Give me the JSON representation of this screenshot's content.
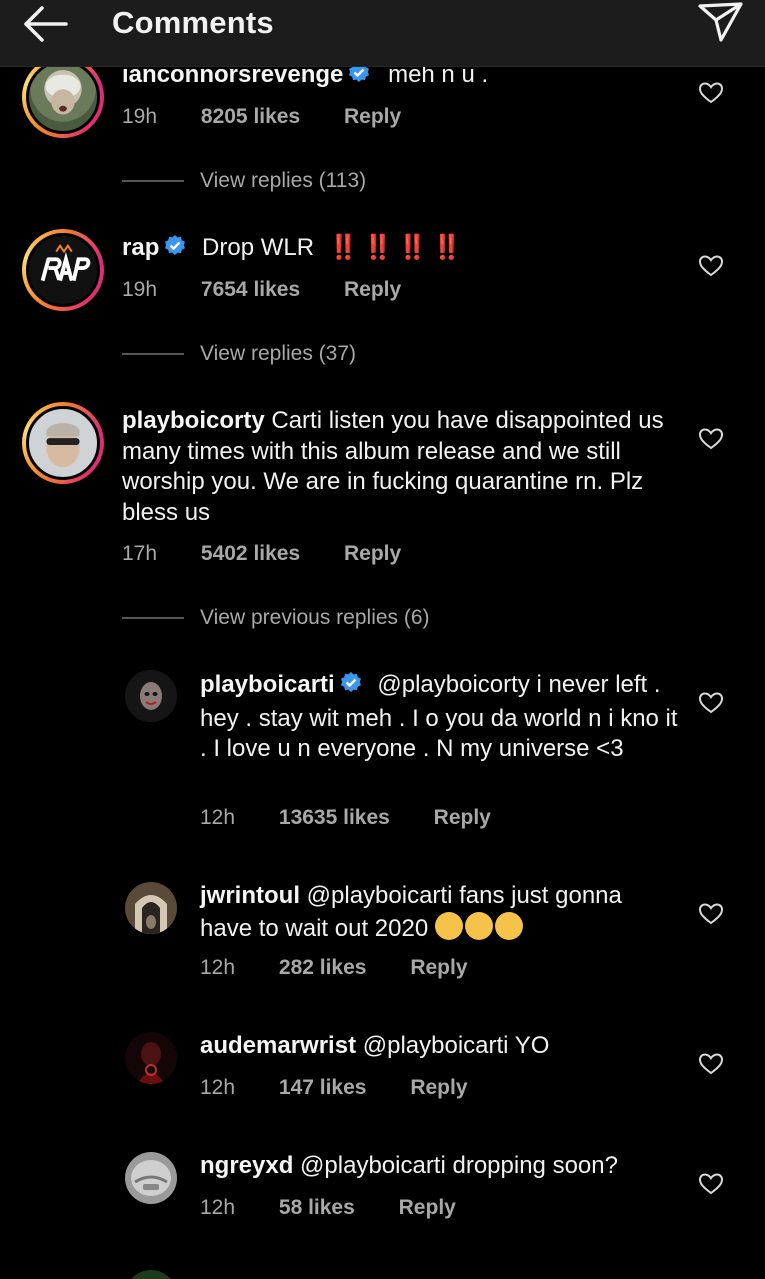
{
  "header": {
    "title": "Comments"
  },
  "comments": [
    {
      "username": "ianconnorsrevenge",
      "text": "meh n u .",
      "time": "19h",
      "likes": "8205 likes",
      "reply": "Reply",
      "view_replies": "View replies (113)"
    },
    {
      "username": "rap",
      "text": "Drop WLR",
      "text_suffix": "‼️ ‼️ ‼️ ‼️",
      "time": "19h",
      "likes": "7654 likes",
      "reply": "Reply",
      "view_replies": "View replies (37)"
    },
    {
      "username": "playboicorty",
      "text": "Carti listen you have disappointed us many times with this album release and we still worship you. We are in fucking quarantine rn. Plz bless us",
      "time": "17h",
      "likes": "5402 likes",
      "reply": "Reply",
      "view_replies": "View previous replies (6)"
    }
  ],
  "replies": [
    {
      "username": "playboicarti",
      "mention": "@playboicorty",
      "text": "i never left . hey . stay wit meh . I o you da world n i kno it . I love u n everyone . N my universe <3",
      "time": "12h",
      "likes": "13635 likes",
      "reply": "Reply"
    },
    {
      "username": "jwrintoul",
      "mention": "@playboicarti",
      "text": "fans just gonna have to wait out 2020",
      "time": "12h",
      "likes": "282 likes",
      "reply": "Reply"
    },
    {
      "username": "audemarwrist",
      "mention": "@playboicarti",
      "text": "YO",
      "time": "12h",
      "likes": "147 likes",
      "reply": "Reply"
    },
    {
      "username": "ngreyxd",
      "mention": "@playboicarti",
      "text": "dropping soon?",
      "time": "12h",
      "likes": "58 likes",
      "reply": "Reply"
    }
  ],
  "colors": {
    "background": "#000000",
    "header_bg": "#1c1c1c",
    "verified_blue": "#3897f0",
    "meta_gray": "#a8a8a8"
  },
  "icons": [
    "back-arrow-icon",
    "send-icon",
    "verified-badge-icon",
    "heart-icon"
  ]
}
